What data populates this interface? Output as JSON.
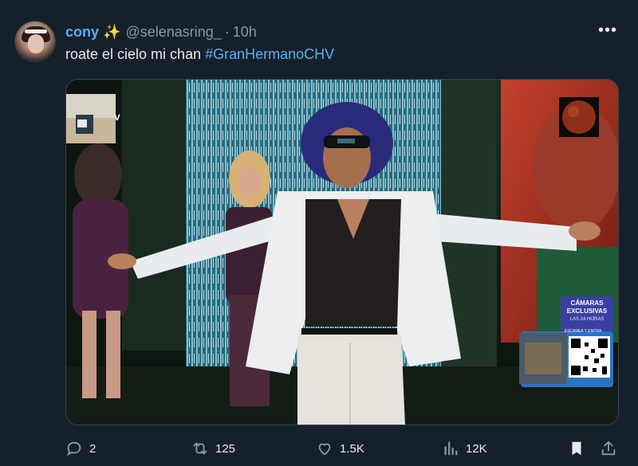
{
  "tweet": {
    "display_name": "cony",
    "name_emoji": "✨",
    "handle": "@selenasring_",
    "separator": "·",
    "time": "10h",
    "text_plain": "roate el cielo mi chan ",
    "hashtag": "#GranHermanoCHV",
    "more_label": "•••"
  },
  "media": {
    "overlay_title_1": "CÁMARAS",
    "overlay_title_2": "EXCLUSIVAS",
    "overlay_sub": "LAS 24 HORAS",
    "overlay_cta": "ESCANEA Y ENTRA",
    "corner_letter": "v"
  },
  "actions": {
    "replies": "2",
    "reposts": "125",
    "likes": "1.5K",
    "views": "12K"
  },
  "colors": {
    "background": "#15202b",
    "accent": "#5ab0f0",
    "muted": "#8b98a5"
  }
}
